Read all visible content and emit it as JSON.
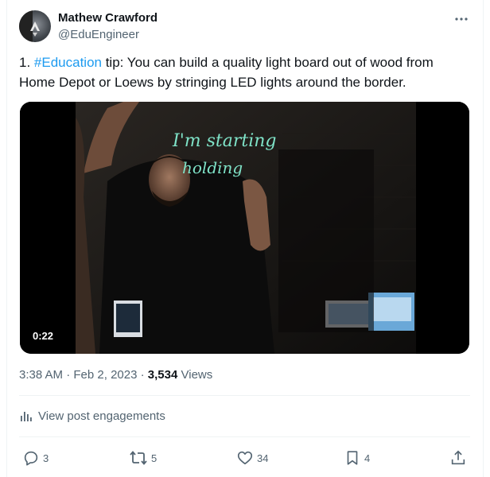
{
  "author": {
    "name": "Mathew Crawford",
    "handle": "@EduEngineer"
  },
  "post": {
    "text_prefix": "1. ",
    "hashtag": "#Education",
    "text_rest": " tip: You can build a quality light board out of wood from Home Depot or Loews by stringing LED lights around the border."
  },
  "media": {
    "duration": "0:22",
    "board_line1": "I'm starting",
    "board_line2": "holding"
  },
  "meta": {
    "time": "3:38 AM",
    "sep1": " · ",
    "date": "Feb 2, 2023",
    "sep2": " · ",
    "views_count": "3,534",
    "views_label": " Views"
  },
  "engagements": {
    "label": "View post engagements"
  },
  "actions": {
    "replies": "3",
    "reposts": "5",
    "likes": "34",
    "bookmarks": "4"
  },
  "icons": {
    "more": "more-horizontal-icon",
    "analytics": "analytics-icon",
    "reply": "reply-icon",
    "repost": "repost-icon",
    "like": "heart-icon",
    "bookmark": "bookmark-icon",
    "share": "share-icon"
  },
  "colors": {
    "accent": "#1d9bf0",
    "secondary_text": "#536471",
    "primary_text": "#0f1419",
    "chalk": "#7fe3c8"
  }
}
